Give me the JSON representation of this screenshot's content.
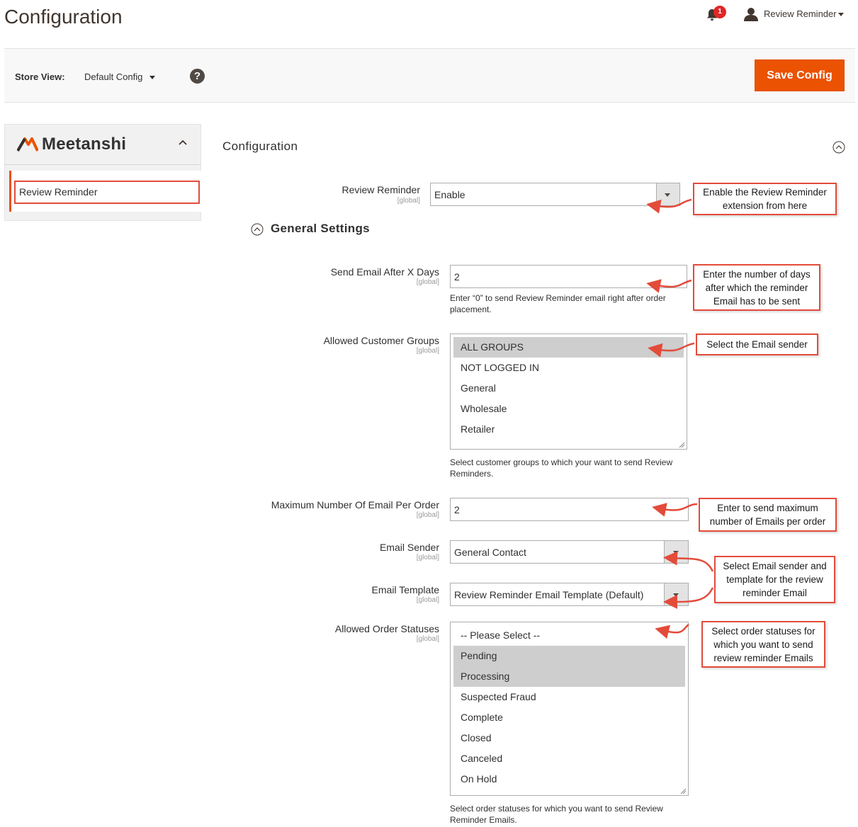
{
  "header": {
    "title": "Configuration",
    "notifications_count": "1",
    "user_name": "Review Reminder"
  },
  "store_bar": {
    "label": "Store View:",
    "value": "Default Config",
    "help": "?",
    "save_label": "Save Config"
  },
  "sidebar": {
    "brand": "Meetanshi",
    "item_label": "Review Reminder"
  },
  "main": {
    "section_title": "Configuration",
    "general_settings_title": "General Settings",
    "fields": {
      "review_reminder": {
        "label": "Review Reminder",
        "scope": "[global]",
        "value": "Enable"
      },
      "send_after_days": {
        "label": "Send Email After X Days",
        "scope": "[global]",
        "value": "2",
        "note": "Enter “0” to send Review Reminder email right after order placement."
      },
      "customer_groups": {
        "label": "Allowed Customer Groups",
        "scope": "[global]",
        "options": [
          "ALL GROUPS",
          "NOT LOGGED IN",
          "General",
          "Wholesale",
          "Retailer"
        ],
        "note": "Select customer groups to which your want to send Review Reminders."
      },
      "max_emails": {
        "label": "Maximum Number Of Email Per Order",
        "scope": "[global]",
        "value": "2"
      },
      "email_sender": {
        "label": "Email Sender",
        "scope": "[global]",
        "value": "General Contact"
      },
      "email_template": {
        "label": "Email Template",
        "scope": "[global]",
        "value": "Review Reminder Email Template (Default)"
      },
      "order_statuses": {
        "label": "Allowed Order Statuses",
        "scope": "[global]",
        "options": [
          "-- Please Select --",
          "Pending",
          "Processing",
          "Suspected Fraud",
          "Complete",
          "Closed",
          "Canceled",
          "On Hold"
        ],
        "note": "Select order statuses for which you want to send Review Reminder Emails."
      }
    }
  },
  "callouts": {
    "enable": "Enable the Review Reminder extension from here",
    "days": "Enter the number of days after which the reminder Email has to be sent",
    "sender": "Select the Email sender",
    "max": "Enter to send maximum number of Emails per order",
    "template": "Select Email sender and template for the review reminder Email",
    "statuses": "Select order statuses for which you want to send review reminder Emails"
  },
  "colors": {
    "accent": "#eb5202",
    "annotation_red": "#e34b3a",
    "selected_option_bg": "#cecece"
  }
}
